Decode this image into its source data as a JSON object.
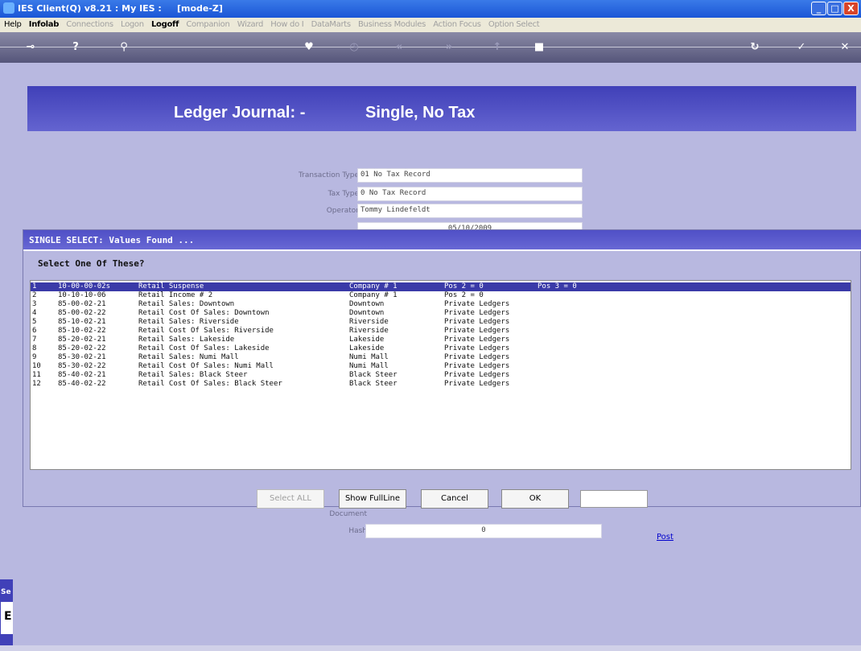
{
  "window": {
    "title": "IES Client(Q) v8.21 : My IES :     [mode-Z]",
    "min": "_",
    "max": "□",
    "close": "X"
  },
  "menu": [
    "Help",
    "Infolab",
    "Connections",
    "Logon",
    "Logoff",
    "Companion",
    "Wizard",
    "How do I",
    "DataMarts",
    "Business Modules",
    "Action Focus",
    "Option Select"
  ],
  "toolbar_icons": [
    "key-icon",
    "help-icon",
    "search-icon",
    "heart-icon",
    "clock-icon",
    "rewind-icon",
    "forward-icon",
    "jump-icon",
    "stop-icon",
    "refresh-icon",
    "check-icon",
    "close-icon"
  ],
  "header": {
    "title": "Ledger Journal: -",
    "subtitle": "Single, No Tax"
  },
  "form": {
    "transaction_type_label": "Transaction Type",
    "transaction_type": "01 No Tax Record",
    "tax_type_label": "Tax Type",
    "tax_type": "0 No Tax Record",
    "operator_label": "Operator",
    "operator": "Tommy Lindefeldt",
    "date": "05/10/2009",
    "document_label": "Document",
    "hash_label": "Hash",
    "hash": "0",
    "post_link": "Post"
  },
  "dialog": {
    "title": "SINGLE SELECT: Values Found ...",
    "prompt": "Select One Of These?",
    "rows": [
      [
        "1",
        "10-00-00-02s",
        "Retail Suspense",
        "Company # 1",
        "Pos 2 = 0",
        "Pos 3 = 0"
      ],
      [
        "2",
        "10-10-10-06",
        "Retail Income # 2",
        "Company # 1",
        "Pos 2 = 0",
        ""
      ],
      [
        "3",
        "85-00-02-21",
        "Retail Sales: Downtown",
        "Downtown",
        "Private Ledgers",
        ""
      ],
      [
        "4",
        "85-00-02-22",
        "Retail Cost Of Sales: Downtown",
        "Downtown",
        "Private Ledgers",
        ""
      ],
      [
        "5",
        "85-10-02-21",
        "Retail Sales: Riverside",
        "Riverside",
        "Private Ledgers",
        ""
      ],
      [
        "6",
        "85-10-02-22",
        "Retail Cost Of Sales: Riverside",
        "Riverside",
        "Private Ledgers",
        ""
      ],
      [
        "7",
        "85-20-02-21",
        "Retail Sales: Lakeside",
        "Lakeside",
        "Private Ledgers",
        ""
      ],
      [
        "8",
        "85-20-02-22",
        "Retail Cost Of Sales: Lakeside",
        "Lakeside",
        "Private Ledgers",
        ""
      ],
      [
        "9",
        "85-30-02-21",
        "Retail Sales: Numi Mall",
        "Numi Mall",
        "Private Ledgers",
        ""
      ],
      [
        "10",
        "85-30-02-22",
        "Retail Cost Of Sales: Numi Mall",
        "Numi Mall",
        "Private Ledgers",
        ""
      ],
      [
        "11",
        "85-40-02-21",
        "Retail Sales: Black Steer",
        "Black Steer",
        "Private Ledgers",
        ""
      ],
      [
        "12",
        "85-40-02-22",
        "Retail Cost Of Sales: Black Steer",
        "Black Steer",
        "Private Ledgers",
        ""
      ]
    ],
    "buttons": {
      "select_all": "Select ALL",
      "show_full_line": "Show FullLine",
      "cancel": "Cancel",
      "ok": "OK"
    },
    "search_value": ""
  },
  "left_panel": {
    "label": "Se",
    "letter": "E"
  }
}
